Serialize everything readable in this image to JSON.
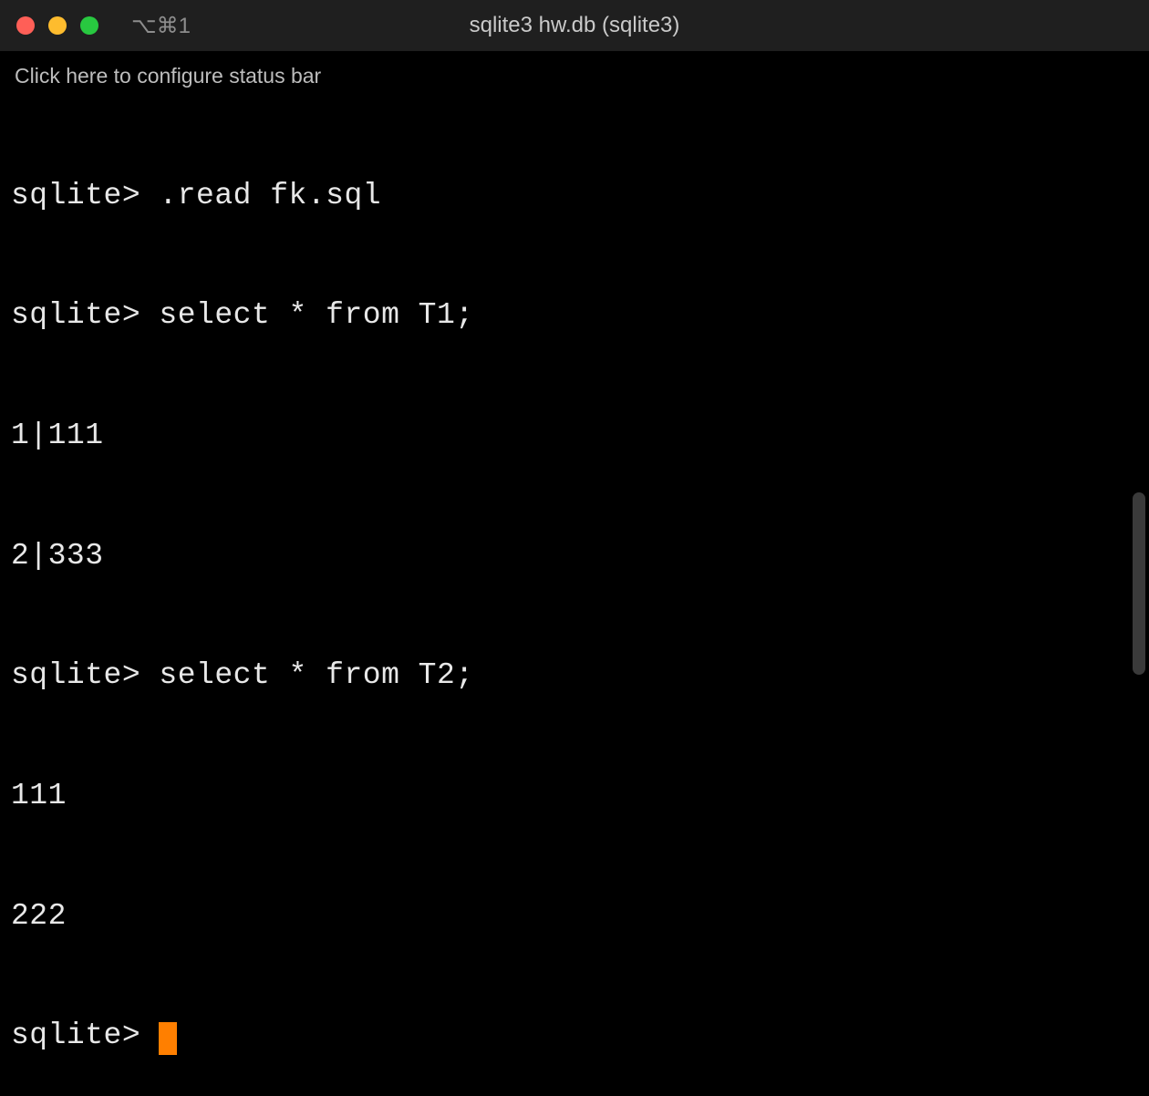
{
  "window": {
    "hotkey": "⌥⌘1",
    "title": "sqlite3 hw.db (sqlite3)"
  },
  "statusbar": {
    "text": "Click here to configure status bar"
  },
  "terminal": {
    "lines": [
      "sqlite> .read fk.sql",
      "sqlite> select * from T1;",
      "1|111",
      "2|333",
      "sqlite> select * from T2;",
      "111",
      "222"
    ],
    "prompt": "sqlite> "
  }
}
